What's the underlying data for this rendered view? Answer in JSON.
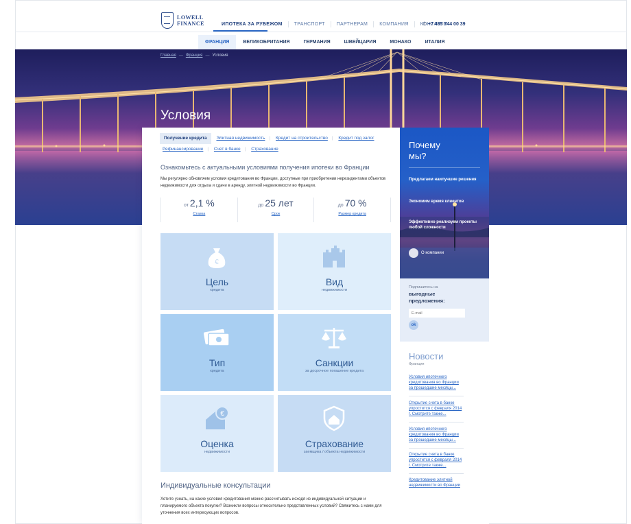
{
  "brand": {
    "name_line1": "LOWELL",
    "name_line2": "FINANCE"
  },
  "topnav": {
    "items": [
      {
        "label": "ИПОТЕКА ЗА РУБЕЖОМ"
      },
      {
        "label": "ТРАНСПОРТ"
      },
      {
        "label": "ПАРТНЕРАМ"
      },
      {
        "label": "КОМПАНИЯ"
      },
      {
        "label": "КОНТАКТЫ"
      }
    ],
    "active_index": 0
  },
  "phone": "+7 495 744 00 39",
  "countrynav": {
    "items": [
      "ФРАНЦИЯ",
      "ВЕЛИКОБРИТАНИЯ",
      "ГЕРМАНИЯ",
      "ШВЕЙЦАРИЯ",
      "МОНАКО",
      "ИТАЛИЯ"
    ],
    "active_index": 0
  },
  "breadcrumb": [
    "Главная",
    "Франция",
    "Условия"
  ],
  "hero_title": "Условия",
  "subtabs": {
    "items": [
      "Получение кредита",
      "Элитная недвижимость",
      "Кредит на строительство",
      "Кредит под залог",
      "Рефинансирование",
      "Счет в банке",
      "Страхование"
    ],
    "active_index": 0
  },
  "intro": {
    "heading": "Ознакомьтесь с актуальными условиями получения ипотеки во Франции",
    "text": "Мы регулярно обновляем условия кредитования во Франции, доступные при приобретении нерезидентами объектов недвижимости для отдыха и сдачи в аренду, элитной недвижимости во Франции."
  },
  "stats": [
    {
      "prefix": "от",
      "value": "2,1 %",
      "label": "Ставка"
    },
    {
      "prefix": "до",
      "value": "25 лет",
      "label": "Срок"
    },
    {
      "prefix": "до",
      "value": "70 %",
      "label": "Размер кредита"
    }
  ],
  "tiles": [
    {
      "title": "Цель",
      "subtitle": "кредита",
      "icon": "money-bag-icon",
      "bg": "#c6dcf4"
    },
    {
      "title": "Вид",
      "subtitle": "недвижимости",
      "icon": "castle-icon",
      "bg": "#dfeefb"
    },
    {
      "title": "Тип",
      "subtitle": "кредита",
      "icon": "banknotes-icon",
      "bg": "#a9cff2"
    },
    {
      "title": "Санкции",
      "subtitle": "за досрочное погашение кредита",
      "icon": "scales-icon",
      "bg": "#c2ddf6"
    },
    {
      "title": "Оценка",
      "subtitle": "недвижимости",
      "icon": "house-euro-icon",
      "bg": "#dcebfa"
    },
    {
      "title": "Страхование",
      "subtitle": "заемщика / объекта недвижимости",
      "icon": "shield-house-icon",
      "bg": "#c6dcf4"
    }
  ],
  "consult": {
    "heading": "Индивидуальные консультации",
    "text": "Хотите узнать, на какие условия кредитования можно рассчитывать исходя из индивидуальной ситуации и планируемого объекта покупки? Возникли вопросы относительно представленных условий? Свяжитесь с нами для уточнения всех интересующих вопросов."
  },
  "why": {
    "heading_line1": "Почему",
    "heading_line2": "мы?",
    "items": [
      "Предлагаем наилучшие решения",
      "Экономим время клиентов",
      "Эффективно реализуем проекты любой сложности"
    ],
    "more": "О компании"
  },
  "subscribe": {
    "small": "Подпишитесь на",
    "big_line1": "выгодные",
    "big_line2": "предложения:",
    "placeholder": "E-mail",
    "button": "ok"
  },
  "news": {
    "heading": "Новости",
    "subheading": "Франция",
    "items": [
      "Условия ипотечного кредитования во Франции за прошедшие месяцы...",
      "Открытие счета в банке упростится с февраля 2014 г. Смотрите также...",
      "Условия ипотечного кредитования во Франции за прошедшие месяцы...",
      "Открытие счета в банке упростится с февраля 2014 г. Смотрите также...",
      "Кредитование элитной недвижимости во Франции"
    ]
  }
}
